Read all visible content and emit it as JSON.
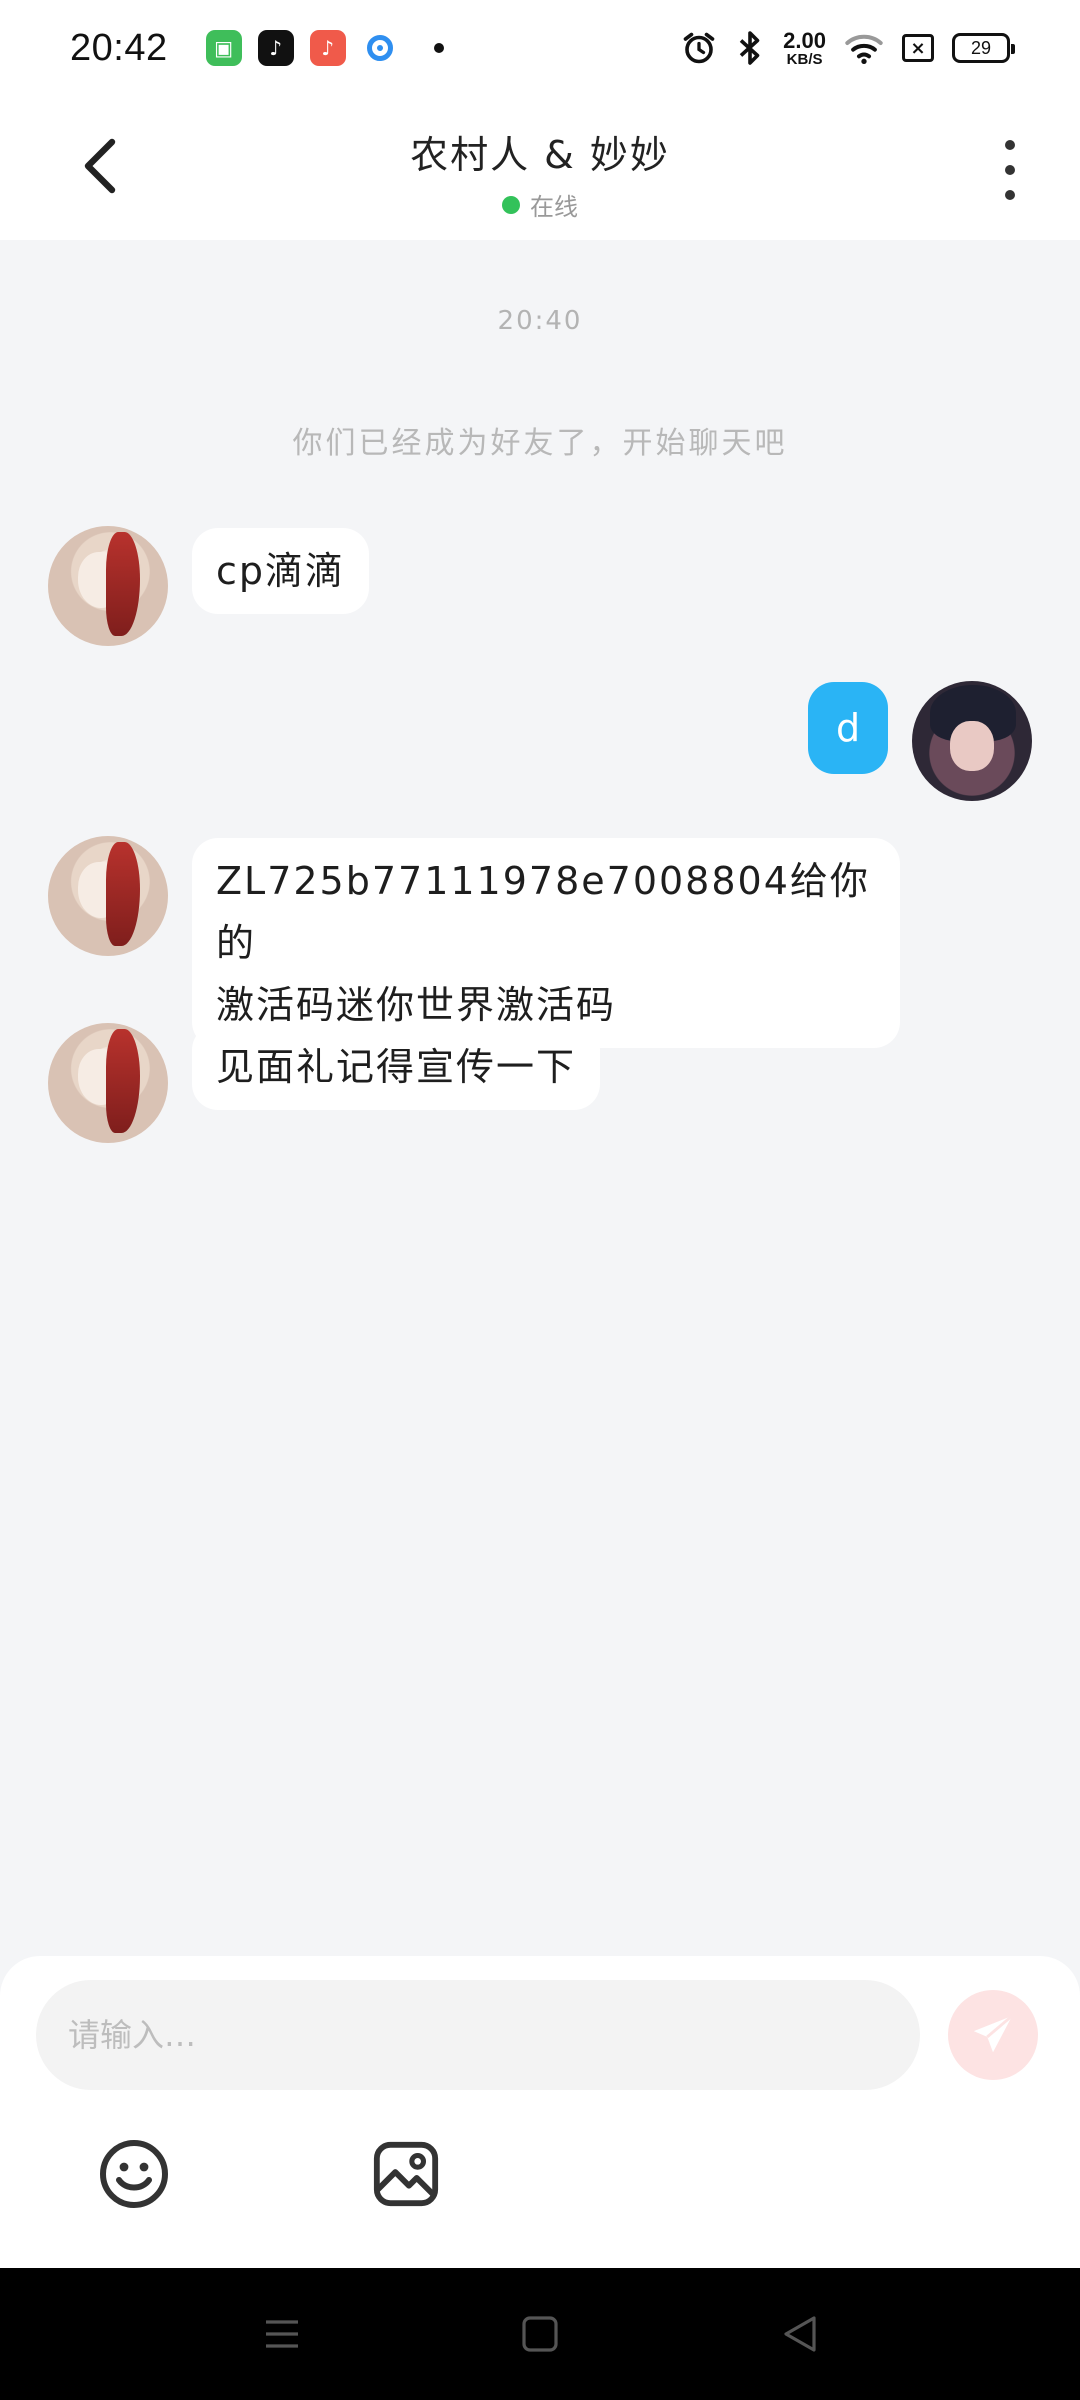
{
  "status_bar": {
    "time": "20:42",
    "net_speed_value": "2.00",
    "net_speed_unit": "KB/S",
    "battery": "29"
  },
  "header": {
    "title": "农村人 & 妙妙",
    "status": "在线"
  },
  "chat": {
    "timestamp": "20:40",
    "system_message": "你们已经成为好友了，开始聊天吧",
    "messages": [
      {
        "side": "left",
        "text": "cp滴滴"
      },
      {
        "side": "right",
        "text": "d"
      },
      {
        "side": "left",
        "line1": "ZL725b77111978e7008804给你的",
        "line2": "激活码迷你世界激活码"
      },
      {
        "side": "left",
        "text": "见面礼记得宣传一下"
      }
    ]
  },
  "composer": {
    "placeholder": "请输入…"
  },
  "colors": {
    "accent_blue": "#2ab4f5",
    "online_green": "#33c25a",
    "send_button": "#fde3e3"
  },
  "icons": {
    "back": "chevron-left-icon",
    "more": "more-vertical-icon",
    "send": "paper-plane-icon",
    "emoji": "smiley-icon",
    "image": "image-icon"
  }
}
